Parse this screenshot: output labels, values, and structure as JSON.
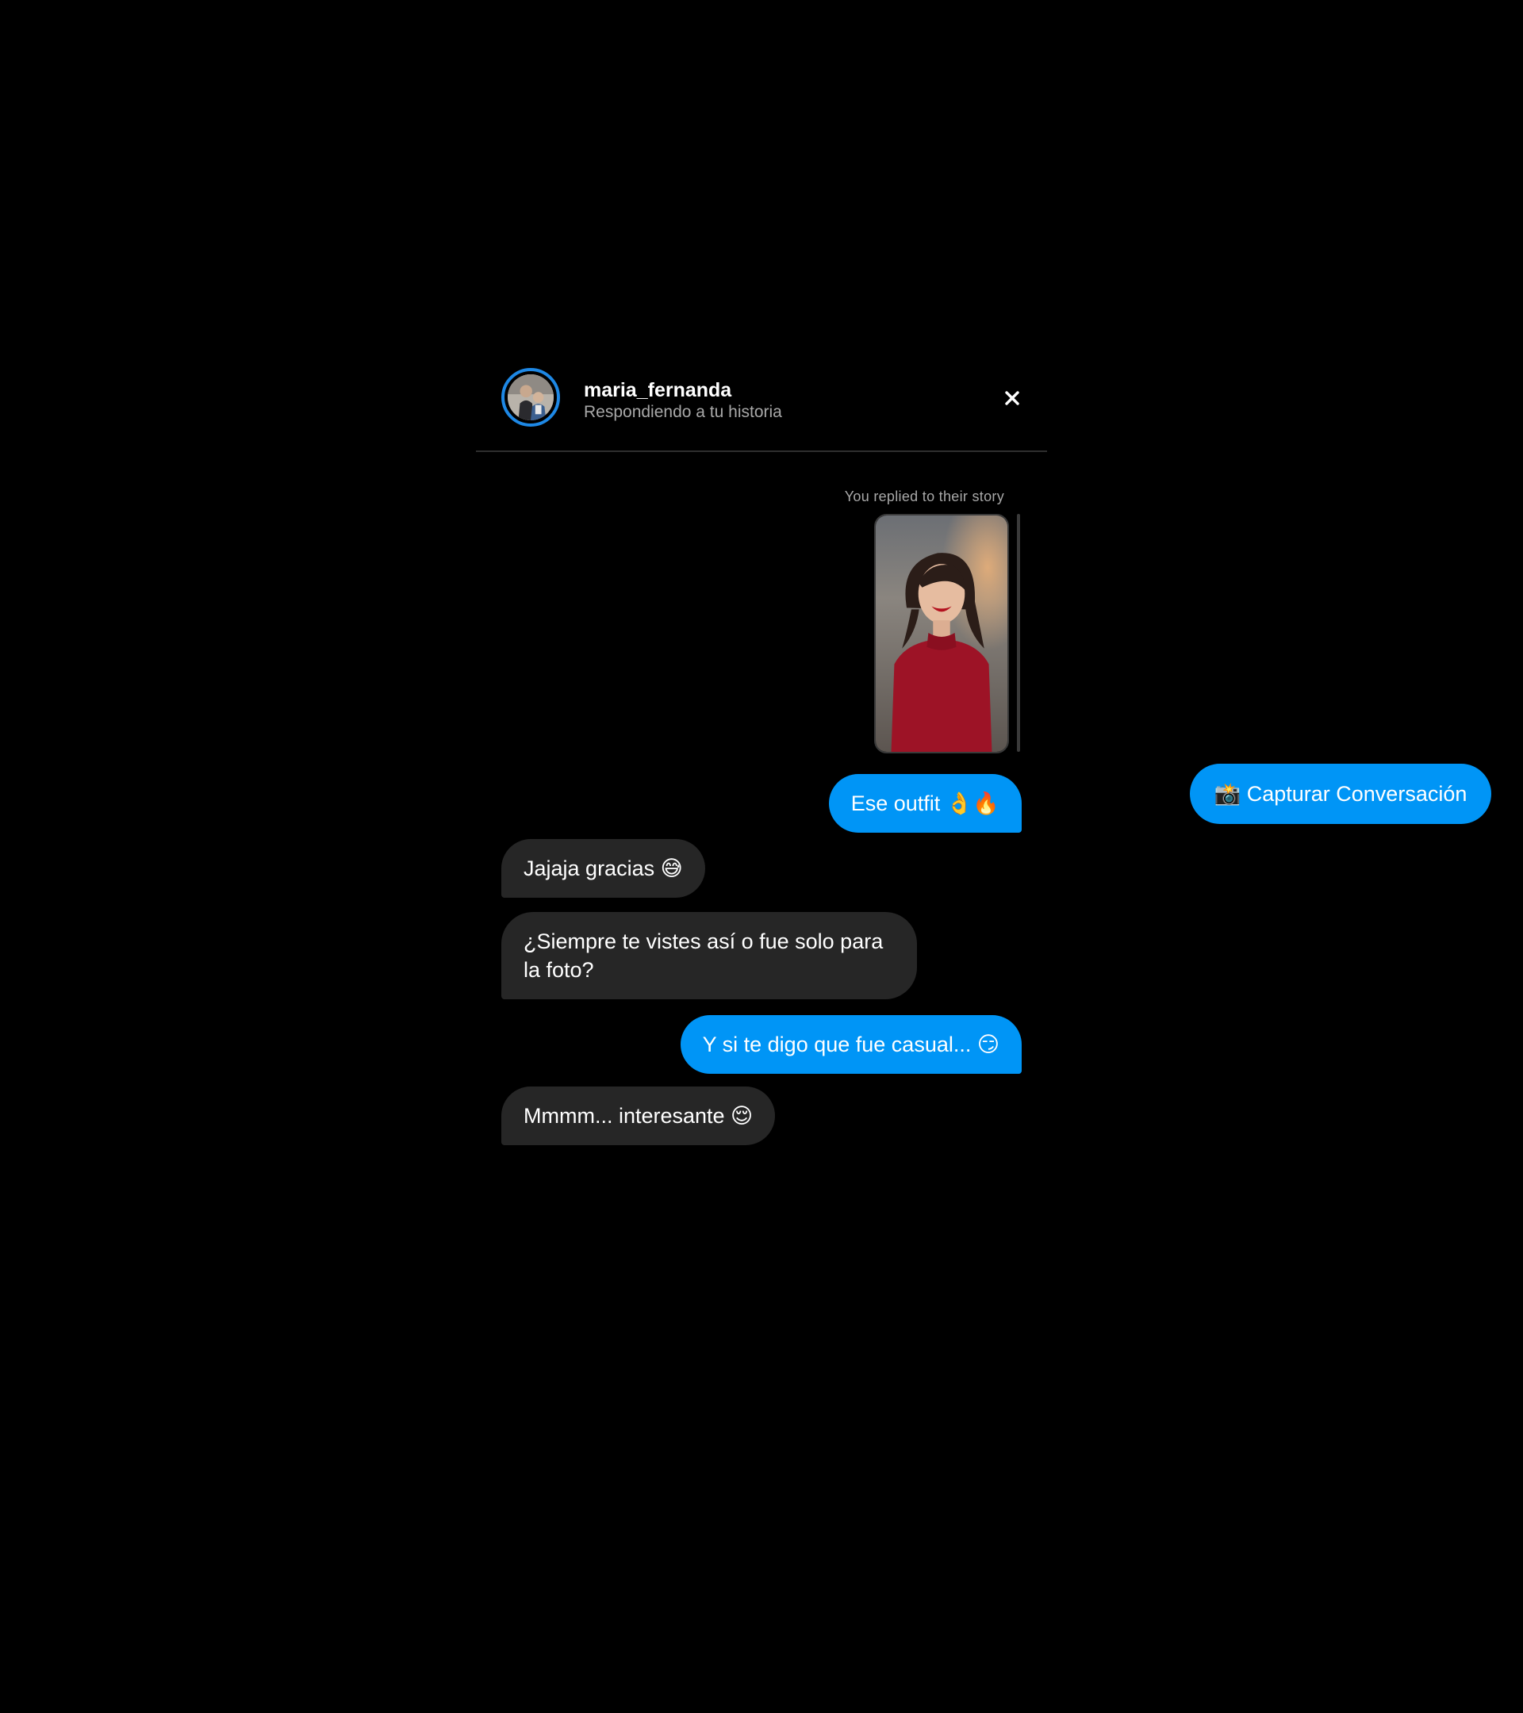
{
  "header": {
    "username": "maria_fernanda",
    "subtitle": "Respondiendo a tu historia",
    "close_icon": "close-icon"
  },
  "story": {
    "label": "You replied to their story"
  },
  "messages": [
    {
      "from": "me",
      "text": "Ese outfit 👌🔥"
    },
    {
      "from": "them",
      "text": "Jajaja gracias 😅"
    },
    {
      "from": "them",
      "text": "¿Siempre te vistes así o fue solo para la foto?"
    },
    {
      "from": "me",
      "text": "Y si te digo que fue casual... 😏"
    },
    {
      "from": "them",
      "text": "Mmmm... interesante 😌"
    }
  ],
  "capture_button": {
    "label": "📸 Capturar Conversación"
  },
  "colors": {
    "background": "#000000",
    "outgoing_bubble": "#0095f6",
    "incoming_bubble": "#262626",
    "avatar_ring": "#1e88e5",
    "secondary_text": "#a8a8a8"
  }
}
